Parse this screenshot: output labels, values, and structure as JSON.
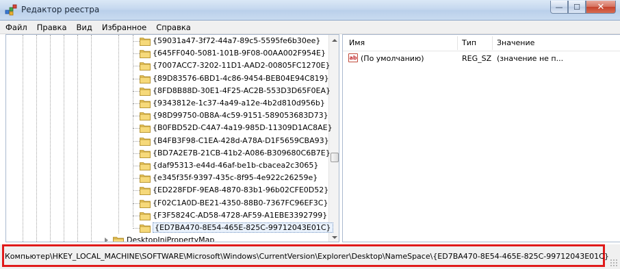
{
  "window": {
    "title": "Редактор реестра",
    "app_icon": "regedit-icon",
    "buttons": {
      "minimize": "—",
      "maximize": "☐",
      "close": "✕"
    }
  },
  "menu": [
    "Файл",
    "Правка",
    "Вид",
    "Избранное",
    "Справка"
  ],
  "tree": {
    "items": [
      "{59031a47-3f72-44a7-89c5-5595fe6b30ee}",
      "{645FF040-5081-101B-9F08-00AA002F954E}",
      "{7007ACC7-3202-11D1-AAD2-00805FC1270E}",
      "{89D83576-6BD1-4c86-9454-BEB04E94C819}",
      "{8FD8B88D-30E1-4F25-AC2B-553D3D65F0EA}",
      "{9343812e-1c37-4a49-a12e-4b2d810d956b}",
      "{98D99750-0B8A-4c59-9151-589053683D73}",
      "{B0FBD52D-C4A7-4a19-985D-11309D1AC8AE}",
      "{B4FB3F98-C1EA-428d-A78A-D1F5659CBA93}",
      "{BD7A2E7B-21CB-41b2-A086-B309680C6B7E}",
      "{daf95313-e44d-46af-be1b-cbacea2c3065}",
      "{e345f35f-9397-435c-8f95-4e922c26259e}",
      "{ED228FDF-9EA8-4870-83b1-96b02CFE0D52}",
      "{F02C1A0D-BE21-4350-88B0-7367FC96EF3C}",
      "{F3F5824C-AD58-4728-AF59-A1EBE3392799}",
      "{ED7BA470-8E54-465E-825C-99712043E01C}"
    ],
    "selected_index": 15,
    "sibling_item": "DesktopIniPropertyMap"
  },
  "values": {
    "columns": {
      "name": "Имя",
      "type": "Тип",
      "data": "Значение"
    },
    "rows": [
      {
        "icon": "string-value-icon",
        "name": "(По умолчанию)",
        "type": "REG_SZ",
        "data": "(значение не п..."
      }
    ]
  },
  "status": {
    "path": "Компьютер\\HKEY_LOCAL_MACHINE\\SOFTWARE\\Microsoft\\Windows\\CurrentVersion\\Explorer\\Desktop\\NameSpace\\{ED7BA470-8E54-465E-825C-99712043E01C}",
    "highlight_color": "#e01a1a"
  }
}
